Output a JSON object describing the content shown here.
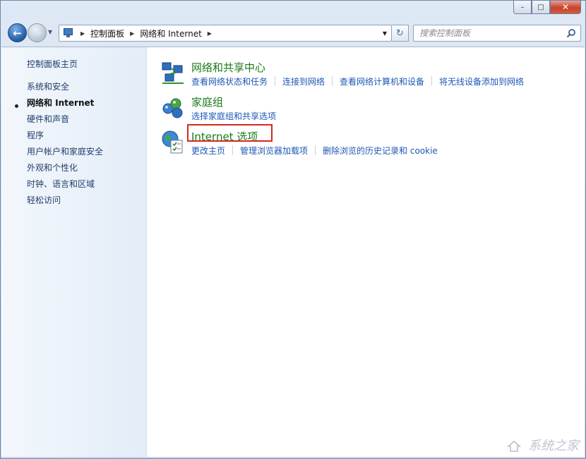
{
  "window": {
    "minimize_glyph": "–",
    "maximize_glyph": "□",
    "close_glyph": "✕"
  },
  "nav": {
    "back_glyph": "←",
    "forward_glyph": "→"
  },
  "address": {
    "crumbs": [
      "控制面板",
      "网络和 Internet"
    ],
    "refresh_glyph": "↻"
  },
  "search": {
    "placeholder": "搜索控制面板"
  },
  "sidebar": {
    "home": "控制面板主页",
    "items": [
      {
        "label": "系统和安全",
        "current": false
      },
      {
        "label": "网络和 Internet",
        "current": true
      },
      {
        "label": "硬件和声音",
        "current": false
      },
      {
        "label": "程序",
        "current": false
      },
      {
        "label": "用户帐户和家庭安全",
        "current": false
      },
      {
        "label": "外观和个性化",
        "current": false
      },
      {
        "label": "时钟、语言和区域",
        "current": false
      },
      {
        "label": "轻松访问",
        "current": false
      }
    ]
  },
  "categories": [
    {
      "title": "网络和共享中心",
      "icon": "network-sharing-icon",
      "links": [
        "查看网络状态和任务",
        "连接到网络",
        "查看网络计算机和设备",
        "将无线设备添加到网络"
      ]
    },
    {
      "title": "家庭组",
      "icon": "homegroup-icon",
      "links": [
        "选择家庭组和共享选项"
      ]
    },
    {
      "title": "Internet 选项",
      "icon": "internet-options-icon",
      "links": [
        "更改主页",
        "管理浏览器加载项",
        "删除浏览的历史记录和 cookie"
      ]
    }
  ],
  "watermark": {
    "text": "系统之家"
  },
  "colors": {
    "category_title": "#1a7a1a",
    "link": "#1d58b5",
    "highlight": "#d9261c"
  }
}
